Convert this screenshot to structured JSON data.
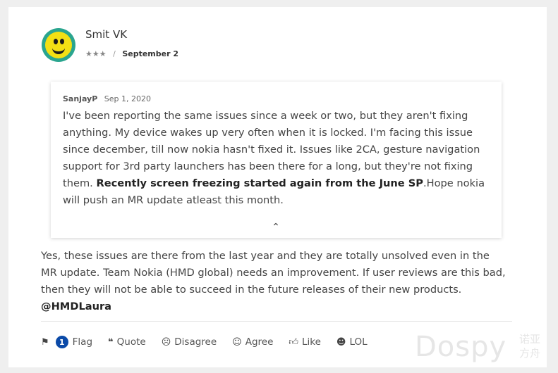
{
  "post": {
    "author": "Smit VK",
    "rank": "★★★",
    "separator": "/",
    "date": "September 2"
  },
  "quote": {
    "user": "SanjayP",
    "date": "Sep 1, 2020",
    "text_1": "I've been reporting the same issues since a week or two, but they aren't fixing anything. My device wakes up very often when it is locked. I'm facing this issue since december, till now nokia hasn't fixed it. Issues like 2CA, gesture navigation support for 3rd party launchers has been there for a long, but they're not fixing them.",
    "text_bold": "Recently screen freezing started again from the June SP",
    "text_2": ".Hope nokia will push an MR update atleast this month.",
    "collapse_glyph": "⌃"
  },
  "reply": {
    "text": "Yes, these issues are there from the last year and they are totally unsolved even in the MR update. Team Nokia (HMD global) needs an improvement. If user reviews are this bad, then they will not be able to succeed in the future releases of their new products. ",
    "mention": "@HMDLaura"
  },
  "actions": {
    "flag_count": "1",
    "flag": "Flag",
    "quote": "Quote",
    "disagree": "Disagree",
    "agree": "Agree",
    "like": "Like",
    "lol": "LOL"
  },
  "watermark": {
    "text": "Dospy",
    "cn_line1": "诺亚",
    "cn_line2": "方舟"
  }
}
